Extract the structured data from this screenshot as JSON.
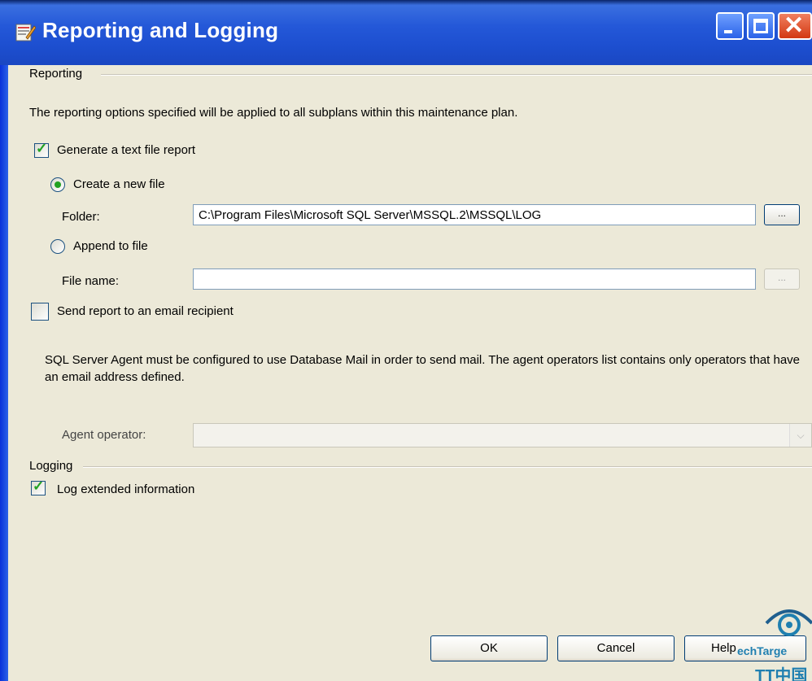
{
  "window": {
    "title": "Reporting and Logging"
  },
  "reporting": {
    "group_label": "Reporting",
    "description": "The reporting options specified will be applied to all subplans within this maintenance plan.",
    "generate_text_report": {
      "label": "Generate a text file report",
      "checked": true
    },
    "create_new_file": {
      "label": "Create a new file",
      "selected": true
    },
    "folder": {
      "label": "Folder:",
      "value": "C:\\Program Files\\Microsoft SQL Server\\MSSQL.2\\MSSQL\\LOG",
      "browse_label": "..."
    },
    "append_to_file": {
      "label": "Append to file",
      "selected": false
    },
    "file_name": {
      "label": "File name:",
      "value": "",
      "browse_label": "..."
    },
    "send_email": {
      "label": "Send report to an email recipient",
      "checked": false
    },
    "agent_note": "SQL Server Agent must be configured to use Database Mail in order to send mail. The agent operators list contains only operators that have an email address defined.",
    "agent_operator": {
      "label": "Agent operator:",
      "value": ""
    }
  },
  "logging": {
    "group_label": "Logging",
    "log_extended": {
      "label": "Log extended information",
      "checked": true
    }
  },
  "buttons": {
    "ok": "OK",
    "cancel": "Cancel",
    "help": "Help"
  },
  "watermark": {
    "line1": "echTarge",
    "line2": "TT中国"
  }
}
